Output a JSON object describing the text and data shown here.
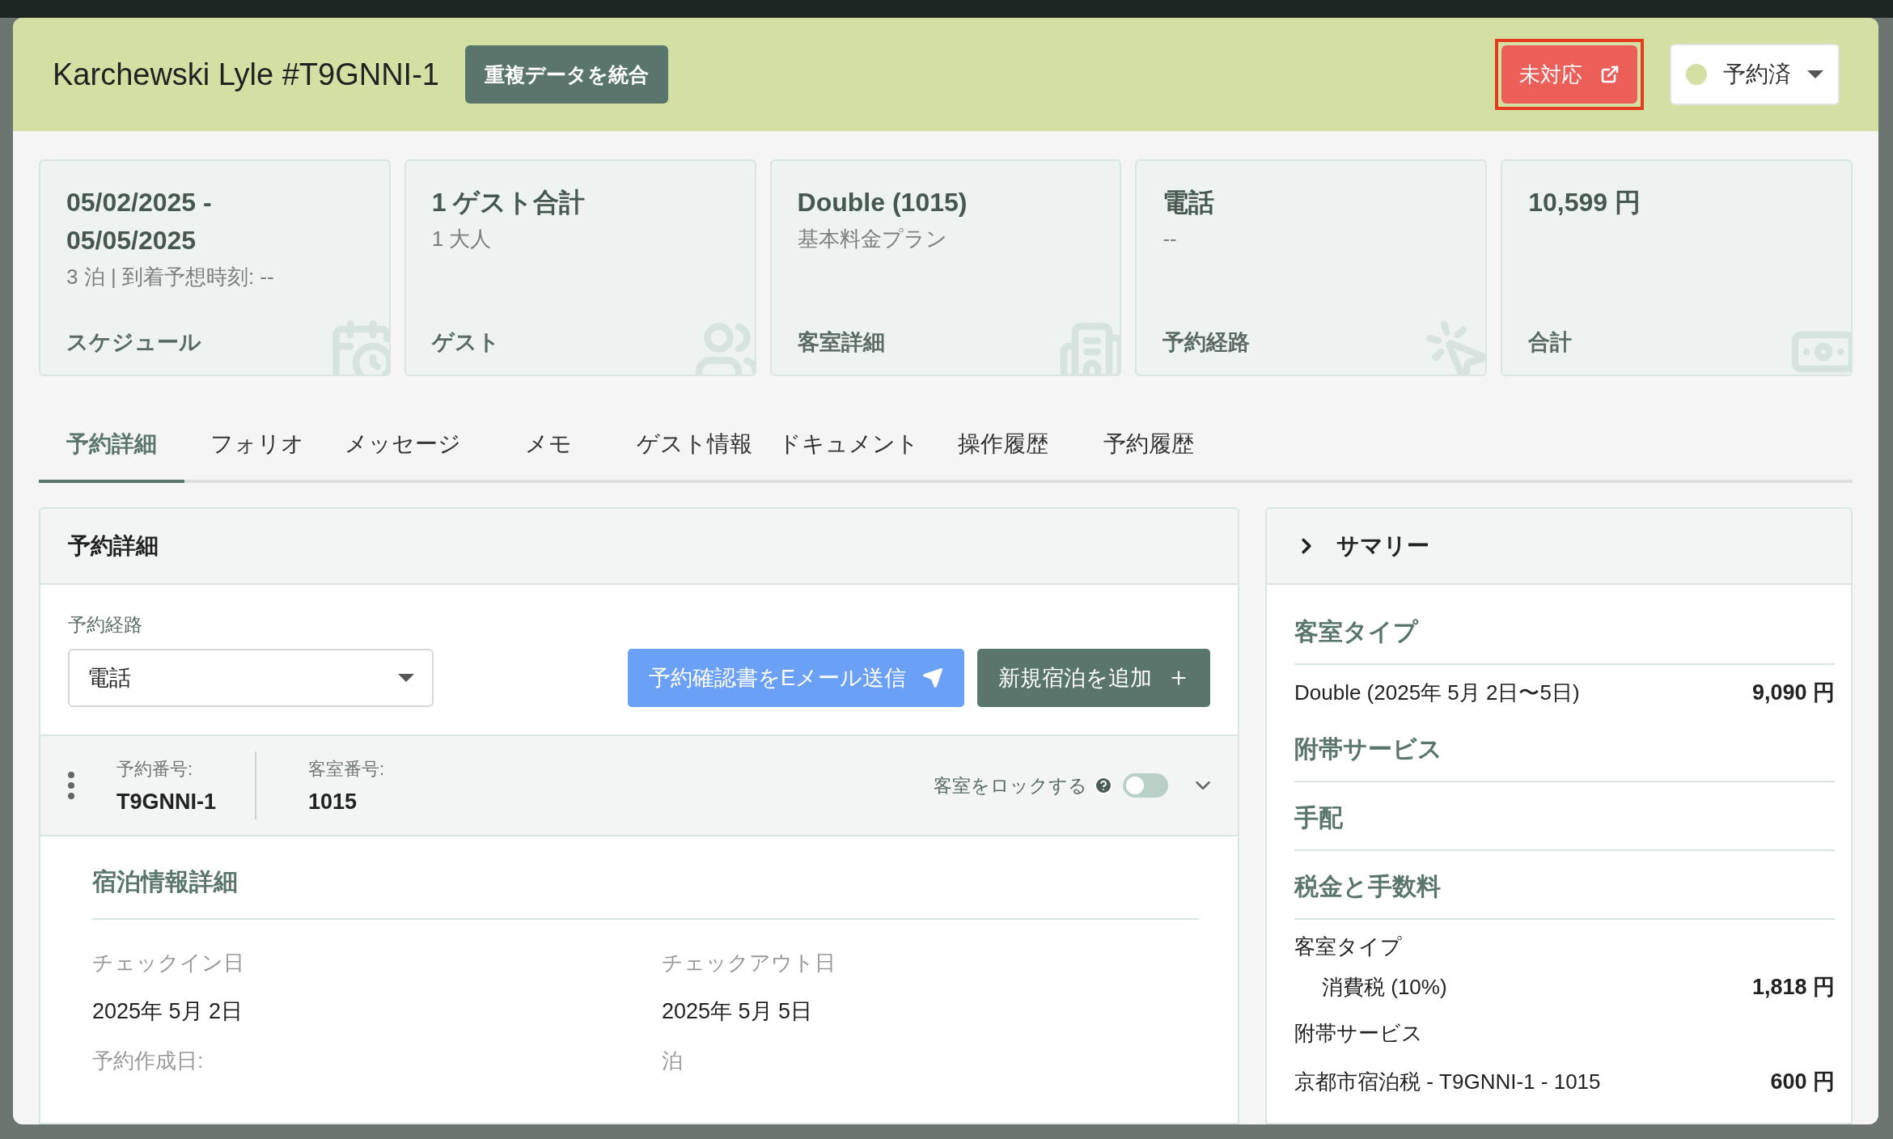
{
  "header": {
    "title": "Karchewski Lyle #T9GNNI-1",
    "merge_button": "重複データを統合",
    "status_button": {
      "label": "未対応",
      "highlighted": true
    },
    "status_select": {
      "value": "予約済"
    }
  },
  "cards": [
    {
      "kind": "schedule",
      "lines": [
        "05/02/2025 -",
        "05/05/2025"
      ],
      "sub": "3 泊 | 到着予想時刻: --",
      "label": "スケジュール"
    },
    {
      "kind": "guest",
      "lines": [
        "1 ゲスト合計"
      ],
      "sub": "1 大人",
      "label": "ゲスト"
    },
    {
      "kind": "room",
      "lines": [
        "Double (1015)"
      ],
      "sub": "基本料金プラン",
      "label": "客室詳細"
    },
    {
      "kind": "source",
      "lines": [
        "電話"
      ],
      "sub": "--",
      "label": "予約経路"
    },
    {
      "kind": "total",
      "lines": [
        "10,599 円"
      ],
      "label": "合計"
    }
  ],
  "tabs": [
    {
      "label": "予約詳細",
      "selected": true
    },
    {
      "label": "フォリオ",
      "selected": false
    },
    {
      "label": "メッセージ",
      "selected": false
    },
    {
      "label": "メモ",
      "selected": false
    },
    {
      "label": "ゲスト情報",
      "selected": false
    },
    {
      "label": "ドキュメント",
      "selected": false
    },
    {
      "label": "操作履歴",
      "selected": false
    },
    {
      "label": "予約履歴",
      "selected": false
    }
  ],
  "details": {
    "title": "予約詳細",
    "source_label": "予約経路",
    "source_value": "電話",
    "email_button": "予約確認書をEメール送信",
    "add_button": "新規宿泊を追加",
    "reservation": {
      "number_label": "予約番号:",
      "number": "T9GNNI-1",
      "room_label": "客室番号:",
      "room": "1015",
      "lock_label": "客室をロックする",
      "lock_on": false
    },
    "stay": {
      "title": "宿泊情報詳細",
      "fields": [
        {
          "label": "チェックイン日",
          "value": "2025年 5月 2日"
        },
        {
          "label": "チェックアウト日",
          "value": "2025年 5月 5日"
        },
        {
          "label": "予約作成日:"
        },
        {
          "label": "泊"
        }
      ]
    }
  },
  "summary": {
    "title": "サマリー",
    "rows": [
      {
        "kind": "heading",
        "label": "客室タイプ"
      },
      {
        "kind": "item",
        "label": "Double (2025年 5月 2日〜5日)",
        "amount": "9,090 円"
      },
      {
        "kind": "heading",
        "label": "附帯サービス"
      },
      {
        "kind": "heading",
        "label": "手配"
      },
      {
        "kind": "heading",
        "label": "税金と手数料"
      },
      {
        "kind": "group",
        "label": "客室タイプ"
      },
      {
        "kind": "subitem",
        "label": "消費税 (10%)",
        "amount": "1,818 円"
      },
      {
        "kind": "group",
        "label": "附帯サービス"
      },
      {
        "kind": "item",
        "label": "京都市宿泊税 - T9GNNI-1 - 1015",
        "amount": "600 円"
      }
    ]
  }
}
